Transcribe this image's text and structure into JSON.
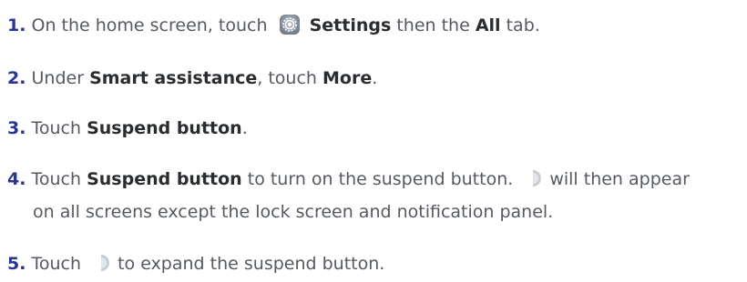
{
  "steps": [
    {
      "number": "1.",
      "t1": "On the home screen, touch",
      "b1": "Settings",
      "t2": " then the ",
      "b2": "All",
      "t3": " tab.",
      "icon": "settings-icon"
    },
    {
      "number": "2.",
      "t1": "Under ",
      "b1": "Smart assistance",
      "t2": ", touch ",
      "b2": "More",
      "t3": "."
    },
    {
      "number": "3.",
      "t1": "Touch ",
      "b1": "Suspend button",
      "t2": "."
    },
    {
      "number": "4.",
      "t1": "Touch ",
      "b1": "Suspend button",
      "t2": " to turn on the suspend button.",
      "t3": "will then appear",
      "line2": "on all screens except the lock screen and notification panel.",
      "icon": "suspend-button-icon"
    },
    {
      "number": "5.",
      "t1": "Touch",
      "t2": "to expand the suspend button.",
      "icon": "suspend-button-icon"
    }
  ],
  "colors": {
    "step_number": "#283592",
    "body_text": "#555a60",
    "bold_text": "#2a2d30"
  }
}
